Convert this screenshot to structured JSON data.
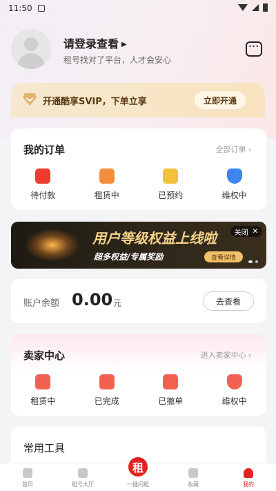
{
  "status_bar": {
    "time": "11:50"
  },
  "profile": {
    "login_title": "请登录查看",
    "subtitle": "租号找对了平台，人才会安心"
  },
  "svip": {
    "text": "开通酷享SVIP，下单立享",
    "button": "立即开通"
  },
  "orders": {
    "title": "我的订单",
    "link": "全部订单",
    "items": [
      {
        "label": "待付款",
        "icon": "wallet-icon"
      },
      {
        "label": "租赁中",
        "icon": "box-icon"
      },
      {
        "label": "已预约",
        "icon": "clipboard-icon"
      },
      {
        "label": "维权中",
        "icon": "shield-icon"
      }
    ]
  },
  "banner": {
    "title": "用户等级权益上线啦",
    "subtitle": "超多权益/专属奖励",
    "cta": "查看详情",
    "close": "关闭"
  },
  "balance": {
    "label": "账户余额",
    "value": "0.00",
    "unit": "元",
    "button": "去查看"
  },
  "seller": {
    "title": "卖家中心",
    "link": "进入卖家中心",
    "items": [
      {
        "label": "租赁中",
        "icon": "box-icon"
      },
      {
        "label": "已完成",
        "icon": "check-doc-icon"
      },
      {
        "label": "已撤单",
        "icon": "cancel-doc-icon"
      },
      {
        "label": "维权中",
        "icon": "shield-icon"
      }
    ]
  },
  "tools": {
    "title": "常用工具"
  },
  "tabbar": {
    "items": [
      {
        "label": "首页"
      },
      {
        "label": "租号大厅"
      },
      {
        "label": "一键闪租",
        "badge": "租"
      },
      {
        "label": "收藏"
      },
      {
        "label": "我的"
      }
    ]
  },
  "colors": {
    "accent": "#e42222",
    "svip_bg": "#f6e8cf",
    "banner_gold": "#f7d28a"
  }
}
